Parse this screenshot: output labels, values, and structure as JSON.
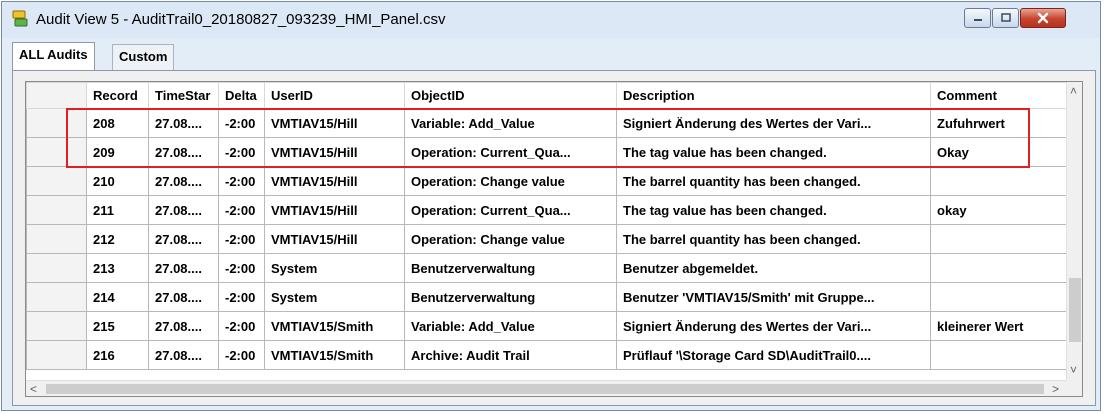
{
  "window": {
    "title": "Audit View 5 - AuditTrail0_20180827_093239_HMI_Panel.csv"
  },
  "tabs": [
    {
      "label": "ALL Audits",
      "active": true
    },
    {
      "label": "Custom",
      "active": false
    }
  ],
  "table": {
    "columns": [
      "Record",
      "TimeStar",
      "Delta",
      "UserID",
      "ObjectID",
      "Description",
      "Comment"
    ],
    "rows": [
      [
        "208",
        "27.08....",
        "-2:00",
        "VMTIAV15/Hill",
        "Variable: Add_Value",
        "Signiert Änderung des Wertes der Vari...",
        "Zufuhrwert"
      ],
      [
        "209",
        "27.08....",
        "-2:00",
        "VMTIAV15/Hill",
        "Operation: Current_Qua...",
        "The tag value has been changed.",
        "Okay"
      ],
      [
        "210",
        "27.08....",
        "-2:00",
        "VMTIAV15/Hill",
        "Operation: Change value",
        "The barrel quantity has been changed.",
        ""
      ],
      [
        "211",
        "27.08....",
        "-2:00",
        "VMTIAV15/Hill",
        "Operation: Current_Qua...",
        "The tag value has been changed.",
        "okay"
      ],
      [
        "212",
        "27.08....",
        "-2:00",
        "VMTIAV15/Hill",
        "Operation: Change value",
        "The barrel quantity has been changed.",
        ""
      ],
      [
        "213",
        "27.08....",
        "-2:00",
        "System",
        "Benutzerverwaltung",
        "Benutzer abgemeldet.",
        ""
      ],
      [
        "214",
        "27.08....",
        "-2:00",
        "System",
        "Benutzerverwaltung",
        "Benutzer 'VMTIAV15/Smith' mit Gruppe...",
        ""
      ],
      [
        "215",
        "27.08....",
        "-2:00",
        "VMTIAV15/Smith",
        "Variable: Add_Value",
        "Signiert Änderung des Wertes der Vari...",
        "kleinerer Wert"
      ],
      [
        "216",
        "27.08....",
        "-2:00",
        "VMTIAV15/Smith",
        "Archive: Audit Trail",
        "Prüflauf '\\Storage Card SD\\AuditTrail0....",
        ""
      ]
    ]
  },
  "colors": {
    "highlight": "#e02020",
    "close_button": "#c7432c"
  }
}
